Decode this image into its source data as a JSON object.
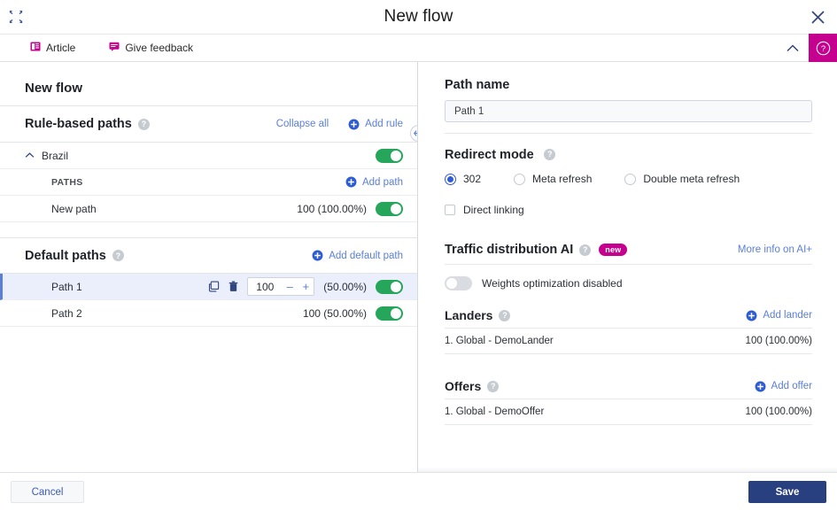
{
  "window": {
    "title": "New flow",
    "expand_icon": "expand-arrows-icon",
    "close_icon": "close-icon"
  },
  "toolbar": {
    "items": [
      {
        "label": "Article",
        "icon": "article-icon"
      },
      {
        "label": "Give feedback",
        "icon": "feedback-icon"
      }
    ],
    "collapse_icon": "chevron-up-icon",
    "help_icon": "help-circle-icon"
  },
  "left": {
    "flow_title": "New flow",
    "rule_based": {
      "title": "Rule-based paths",
      "help_icon": "question-mark-icon",
      "collapse_all": "Collapse all",
      "add_rule": "Add rule",
      "rules": [
        {
          "name": "Brazil",
          "enabled": true,
          "caret": "chevron-up-icon"
        }
      ],
      "paths_caption": "PATHS",
      "add_path": "Add path",
      "paths": [
        {
          "name": "New path",
          "weight": "100 (100.00%)",
          "enabled": true
        }
      ]
    },
    "default_paths": {
      "title": "Default paths",
      "help_icon": "question-mark-icon",
      "add_default_path": "Add default path",
      "rows": [
        {
          "name": "Path 1",
          "selected": true,
          "weight_value": "100",
          "percent": "(50.00%)",
          "enabled": true,
          "copy_icon": "copy-icon",
          "delete_icon": "trash-icon",
          "minus_label": "–",
          "plus_label": "+"
        },
        {
          "name": "Path 2",
          "selected": false,
          "weight_text": "100 (50.00%)",
          "enabled": true
        }
      ]
    },
    "splitter_icon": "horizontal-resize-icon"
  },
  "right": {
    "path_name_label": "Path name",
    "path_name_value": "Path 1",
    "path_name_placeholder": "Path name",
    "redirect_mode_label": "Redirect mode",
    "redirect_options": [
      {
        "label": "302",
        "checked": true
      },
      {
        "label": "Meta refresh",
        "checked": false
      },
      {
        "label": "Double meta refresh",
        "checked": false
      }
    ],
    "direct_linking_label": "Direct linking",
    "direct_linking_checked": false,
    "traffic_ai": {
      "title": "Traffic distribution AI",
      "badge": "new",
      "more_info": "More info on AI+",
      "toggle_label": "Weights optimization disabled",
      "toggle_on": false
    },
    "landers": {
      "title": "Landers",
      "add_label": "Add lander",
      "rows": [
        {
          "name": "1. Global - DemoLander",
          "amount": "100 (100.00%)"
        }
      ]
    },
    "offers": {
      "title": "Offers",
      "add_label": "Add offer",
      "rows": [
        {
          "name": "1. Global - DemoOffer",
          "amount": "100 (100.00%)"
        }
      ]
    }
  },
  "footer": {
    "cancel": "Cancel",
    "save": "Save"
  },
  "colors": {
    "accent_magenta": "#c5008f",
    "link_blue": "#5a7fd6",
    "toggle_green": "#26a65b",
    "save_navy": "#28407f",
    "selected_row": "#eaeffb"
  }
}
